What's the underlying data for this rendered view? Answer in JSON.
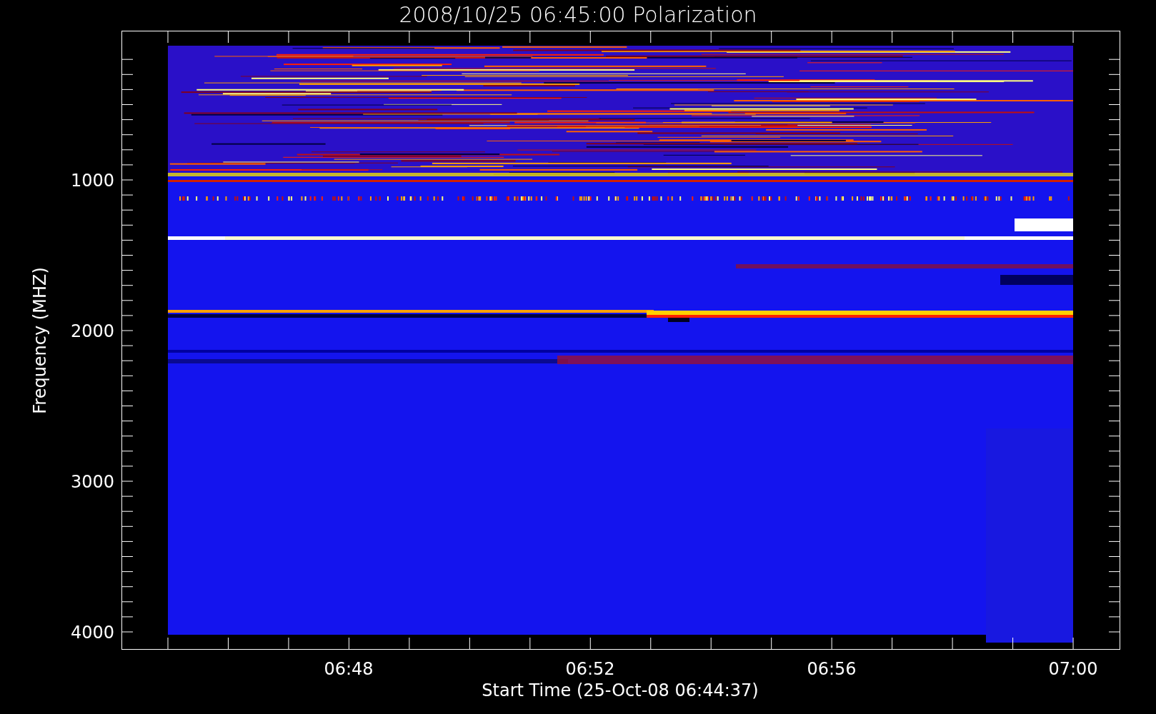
{
  "title": "2008/10/25 06:45:00 Polarization",
  "y_axis": {
    "label": "Frequency (MHZ)",
    "tick_labels": [
      "1000",
      "2000",
      "3000",
      "4000"
    ]
  },
  "x_axis": {
    "label": "Start Time (25-Oct-08 06:44:37)",
    "tick_labels": [
      "06:48",
      "06:52",
      "06:56",
      "07:00"
    ]
  }
}
